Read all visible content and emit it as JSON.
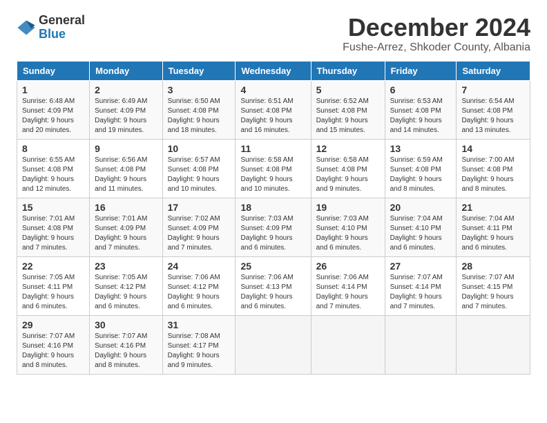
{
  "logo": {
    "general": "General",
    "blue": "Blue"
  },
  "header": {
    "month": "December 2024",
    "location": "Fushe-Arrez, Shkoder County, Albania"
  },
  "weekdays": [
    "Sunday",
    "Monday",
    "Tuesday",
    "Wednesday",
    "Thursday",
    "Friday",
    "Saturday"
  ],
  "weeks": [
    [
      {
        "day": 1,
        "sunrise": "6:48 AM",
        "sunset": "4:09 PM",
        "daylight": "9 hours and 20 minutes."
      },
      {
        "day": 2,
        "sunrise": "6:49 AM",
        "sunset": "4:09 PM",
        "daylight": "9 hours and 19 minutes."
      },
      {
        "day": 3,
        "sunrise": "6:50 AM",
        "sunset": "4:08 PM",
        "daylight": "9 hours and 18 minutes."
      },
      {
        "day": 4,
        "sunrise": "6:51 AM",
        "sunset": "4:08 PM",
        "daylight": "9 hours and 16 minutes."
      },
      {
        "day": 5,
        "sunrise": "6:52 AM",
        "sunset": "4:08 PM",
        "daylight": "9 hours and 15 minutes."
      },
      {
        "day": 6,
        "sunrise": "6:53 AM",
        "sunset": "4:08 PM",
        "daylight": "9 hours and 14 minutes."
      },
      {
        "day": 7,
        "sunrise": "6:54 AM",
        "sunset": "4:08 PM",
        "daylight": "9 hours and 13 minutes."
      }
    ],
    [
      {
        "day": 8,
        "sunrise": "6:55 AM",
        "sunset": "4:08 PM",
        "daylight": "9 hours and 12 minutes."
      },
      {
        "day": 9,
        "sunrise": "6:56 AM",
        "sunset": "4:08 PM",
        "daylight": "9 hours and 11 minutes."
      },
      {
        "day": 10,
        "sunrise": "6:57 AM",
        "sunset": "4:08 PM",
        "daylight": "9 hours and 10 minutes."
      },
      {
        "day": 11,
        "sunrise": "6:58 AM",
        "sunset": "4:08 PM",
        "daylight": "9 hours and 10 minutes."
      },
      {
        "day": 12,
        "sunrise": "6:58 AM",
        "sunset": "4:08 PM",
        "daylight": "9 hours and 9 minutes."
      },
      {
        "day": 13,
        "sunrise": "6:59 AM",
        "sunset": "4:08 PM",
        "daylight": "9 hours and 8 minutes."
      },
      {
        "day": 14,
        "sunrise": "7:00 AM",
        "sunset": "4:08 PM",
        "daylight": "9 hours and 8 minutes."
      }
    ],
    [
      {
        "day": 15,
        "sunrise": "7:01 AM",
        "sunset": "4:08 PM",
        "daylight": "9 hours and 7 minutes."
      },
      {
        "day": 16,
        "sunrise": "7:01 AM",
        "sunset": "4:09 PM",
        "daylight": "9 hours and 7 minutes."
      },
      {
        "day": 17,
        "sunrise": "7:02 AM",
        "sunset": "4:09 PM",
        "daylight": "9 hours and 7 minutes."
      },
      {
        "day": 18,
        "sunrise": "7:03 AM",
        "sunset": "4:09 PM",
        "daylight": "9 hours and 6 minutes."
      },
      {
        "day": 19,
        "sunrise": "7:03 AM",
        "sunset": "4:10 PM",
        "daylight": "9 hours and 6 minutes."
      },
      {
        "day": 20,
        "sunrise": "7:04 AM",
        "sunset": "4:10 PM",
        "daylight": "9 hours and 6 minutes."
      },
      {
        "day": 21,
        "sunrise": "7:04 AM",
        "sunset": "4:11 PM",
        "daylight": "9 hours and 6 minutes."
      }
    ],
    [
      {
        "day": 22,
        "sunrise": "7:05 AM",
        "sunset": "4:11 PM",
        "daylight": "9 hours and 6 minutes."
      },
      {
        "day": 23,
        "sunrise": "7:05 AM",
        "sunset": "4:12 PM",
        "daylight": "9 hours and 6 minutes."
      },
      {
        "day": 24,
        "sunrise": "7:06 AM",
        "sunset": "4:12 PM",
        "daylight": "9 hours and 6 minutes."
      },
      {
        "day": 25,
        "sunrise": "7:06 AM",
        "sunset": "4:13 PM",
        "daylight": "9 hours and 6 minutes."
      },
      {
        "day": 26,
        "sunrise": "7:06 AM",
        "sunset": "4:14 PM",
        "daylight": "9 hours and 7 minutes."
      },
      {
        "day": 27,
        "sunrise": "7:07 AM",
        "sunset": "4:14 PM",
        "daylight": "9 hours and 7 minutes."
      },
      {
        "day": 28,
        "sunrise": "7:07 AM",
        "sunset": "4:15 PM",
        "daylight": "9 hours and 7 minutes."
      }
    ],
    [
      {
        "day": 29,
        "sunrise": "7:07 AM",
        "sunset": "4:16 PM",
        "daylight": "9 hours and 8 minutes."
      },
      {
        "day": 30,
        "sunrise": "7:07 AM",
        "sunset": "4:16 PM",
        "daylight": "9 hours and 8 minutes."
      },
      {
        "day": 31,
        "sunrise": "7:08 AM",
        "sunset": "4:17 PM",
        "daylight": "9 hours and 9 minutes."
      },
      null,
      null,
      null,
      null
    ]
  ]
}
